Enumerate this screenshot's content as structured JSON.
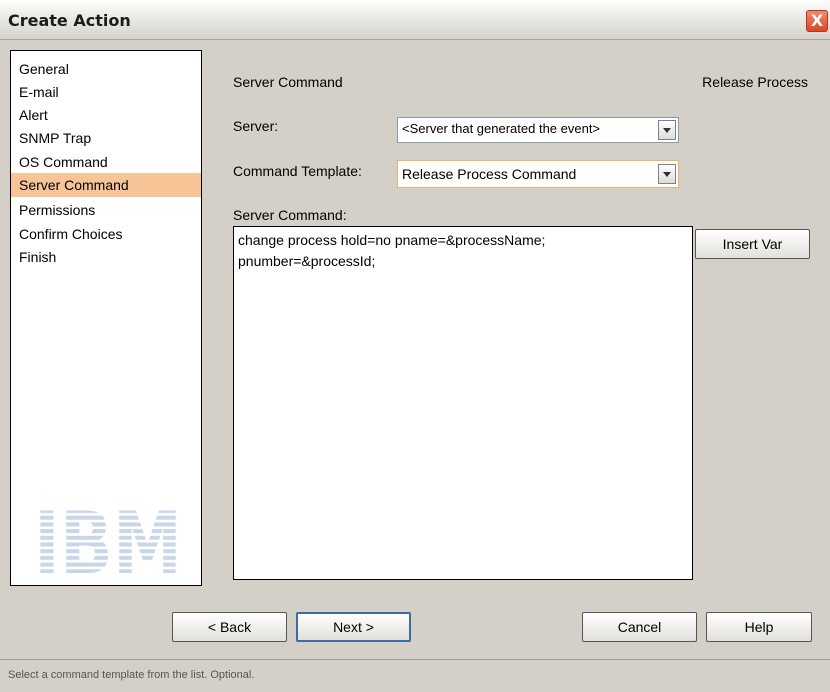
{
  "window": {
    "title": "Create Action",
    "close_label": "X"
  },
  "steps": [
    {
      "label": "General",
      "selected": false
    },
    {
      "label": "E-mail",
      "selected": false
    },
    {
      "label": "Alert",
      "selected": false
    },
    {
      "label": "SNMP Trap",
      "selected": false
    },
    {
      "label": "OS Command",
      "selected": false
    },
    {
      "label": "Server Command",
      "selected": true
    },
    {
      "label": "Permissions",
      "selected": false
    },
    {
      "label": "Confirm Choices",
      "selected": false
    },
    {
      "label": "Finish",
      "selected": false
    }
  ],
  "logo": {
    "text": "IBM",
    "icon": "ibm-logo"
  },
  "panel": {
    "heading": "Server Command",
    "heading_right": "Release Process",
    "server_label": "Server:",
    "server_value": "<Server that generated the event>",
    "template_label": "Command Template:",
    "template_value": "Release Process Command",
    "command_label": "Server Command:",
    "command_lines": [
      "change process hold=no pname=&processName;",
      "pnumber=&processId;"
    ],
    "insert_var_label": "Insert Var"
  },
  "buttons": {
    "back": "< Back",
    "next": "Next >",
    "cancel": "Cancel",
    "help": "Help"
  },
  "status": {
    "text": "Select a command template from the list. Optional."
  },
  "colors": {
    "selected_step": "#f7c497",
    "accent_border": "#3d6ba8",
    "template_focus": "#e8b36a"
  }
}
